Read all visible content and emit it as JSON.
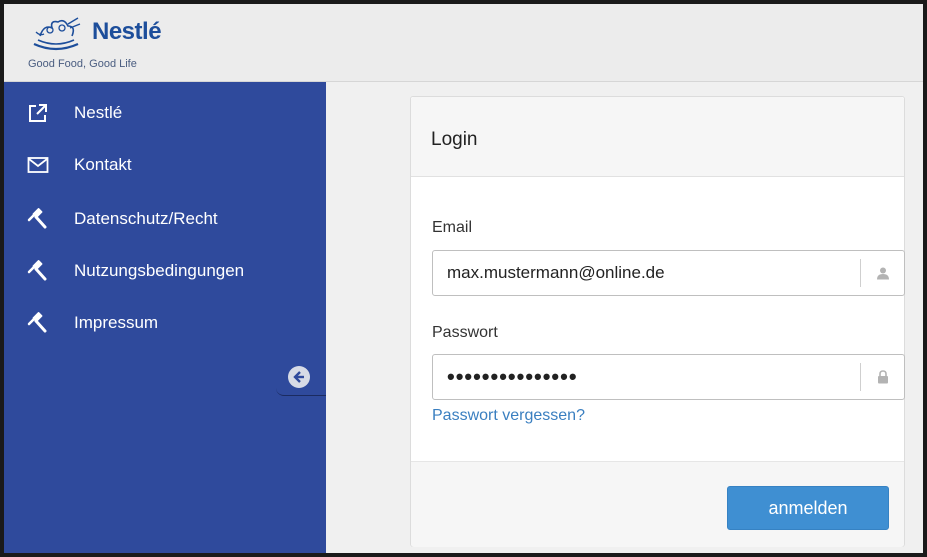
{
  "brand": {
    "wordmark": "Nestlé",
    "tagline": "Good Food, Good Life",
    "color": "#1d4e9b"
  },
  "sidebar": {
    "background": "#2f4a9c",
    "items": [
      {
        "label": "Nestlé",
        "icon": "external-link-icon"
      },
      {
        "label": "Kontakt",
        "icon": "envelope-icon"
      },
      {
        "label": "Datenschutz/Recht",
        "icon": "gavel-icon"
      },
      {
        "label": "Nutzungsbedingungen",
        "icon": "gavel-icon"
      },
      {
        "label": "Impressum",
        "icon": "gavel-icon"
      }
    ],
    "collapse_icon": "arrow-circle-left-icon"
  },
  "login": {
    "title": "Login",
    "email_label": "Email",
    "email_value": "max.mustermann@online.de",
    "email_icon": "user-icon",
    "password_label": "Passwort",
    "password_value": "•••••••••••••••",
    "password_icon": "lock-icon",
    "forgot_link": "Passwort vergessen?",
    "submit_label": "anmelden",
    "accent": "#3f8fd2"
  }
}
